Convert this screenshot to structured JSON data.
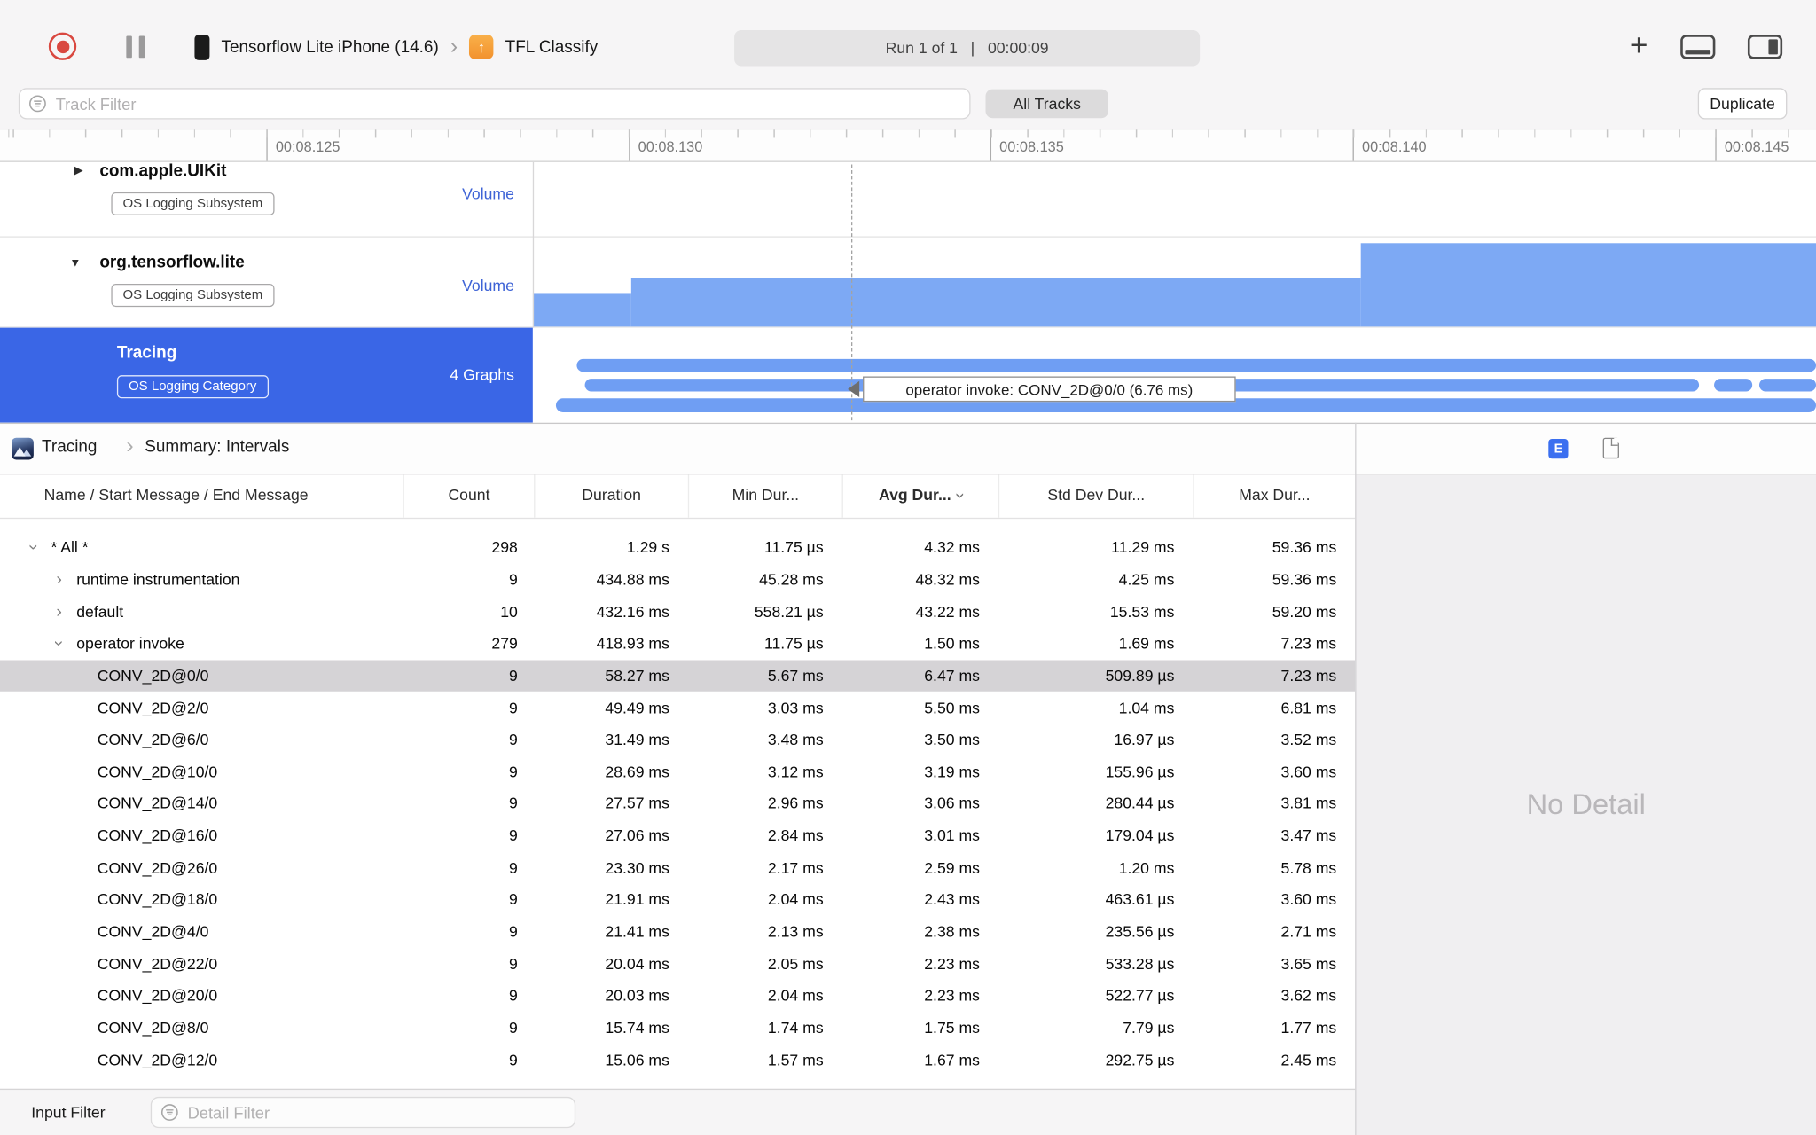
{
  "colors": {
    "record_red": "#d94840",
    "selection_blue": "#3a66e6",
    "bar_blue": "#7da9f4",
    "interval_blue": "#6f9ef3",
    "link_blue": "#3e63d6",
    "badge_blue": "#3b6ff0"
  },
  "icons": {
    "plus": "+",
    "chevron_right": "›",
    "triangle_collapsed": "▶",
    "triangle_expanded": "▼",
    "up_arrow": "↑"
  },
  "toolbar": {
    "device": "Tensorflow Lite iPhone (14.6)",
    "target": "TFL Classify",
    "run_status": "Run 1 of 1   |   00:00:09"
  },
  "filter_bar": {
    "track_filter_placeholder": "Track Filter",
    "all_tracks_label": "All Tracks",
    "duplicate_label": "Duplicate"
  },
  "ruler": {
    "labels": [
      "00:08.125",
      "00:08.130",
      "00:08.135",
      "00:08.140",
      "00:08.145"
    ]
  },
  "tracks": [
    {
      "name": "com.apple.UIKit",
      "badge": "OS Logging Subsystem",
      "meta": "Volume",
      "disclosure": "collapsed",
      "selected": false
    },
    {
      "name": "org.tensorflow.lite",
      "badge": "OS Logging Subsystem",
      "meta": "Volume",
      "disclosure": "expanded",
      "selected": false
    },
    {
      "name": "Tracing",
      "badge": "OS Logging Category",
      "meta": "4 Graphs",
      "disclosure": "none",
      "selected": true
    }
  ],
  "tooltip": {
    "text": "operator invoke: CONV_2D@0/0 (6.76 ms)"
  },
  "detail": {
    "breadcrumb": {
      "instrument": "Tracing",
      "page": "Summary: Intervals"
    },
    "inspector_badge": "E",
    "no_detail": "No Detail"
  },
  "table": {
    "headers": [
      "Name / Start Message / End Message",
      "Count",
      "Duration",
      "Min Dur...",
      "Avg Dur...",
      "Std Dev Dur...",
      "Max Dur..."
    ],
    "sorted_by": "Avg Dur...",
    "rows": [
      {
        "name": "* All *",
        "indent": 0,
        "chevron": "open",
        "count": "298",
        "duration": "1.29 s",
        "min": "11.75 µs",
        "avg": "4.32 ms",
        "std": "11.29 ms",
        "max": "59.36 ms",
        "selected": false
      },
      {
        "name": "runtime instrumentation",
        "indent": 1,
        "chevron": "closed",
        "count": "9",
        "duration": "434.88 ms",
        "min": "45.28 ms",
        "avg": "48.32 ms",
        "std": "4.25 ms",
        "max": "59.36 ms",
        "selected": false
      },
      {
        "name": "default",
        "indent": 1,
        "chevron": "closed",
        "count": "10",
        "duration": "432.16 ms",
        "min": "558.21 µs",
        "avg": "43.22 ms",
        "std": "15.53 ms",
        "max": "59.20 ms",
        "selected": false
      },
      {
        "name": "operator invoke",
        "indent": 1,
        "chevron": "open",
        "count": "279",
        "duration": "418.93 ms",
        "min": "11.75 µs",
        "avg": "1.50 ms",
        "std": "1.69 ms",
        "max": "7.23 ms",
        "selected": false
      },
      {
        "name": "CONV_2D@0/0",
        "indent": 2,
        "chevron": "none",
        "count": "9",
        "duration": "58.27 ms",
        "min": "5.67 ms",
        "avg": "6.47 ms",
        "std": "509.89 µs",
        "max": "7.23 ms",
        "selected": true
      },
      {
        "name": "CONV_2D@2/0",
        "indent": 2,
        "chevron": "none",
        "count": "9",
        "duration": "49.49 ms",
        "min": "3.03 ms",
        "avg": "5.50 ms",
        "std": "1.04 ms",
        "max": "6.81 ms",
        "selected": false
      },
      {
        "name": "CONV_2D@6/0",
        "indent": 2,
        "chevron": "none",
        "count": "9",
        "duration": "31.49 ms",
        "min": "3.48 ms",
        "avg": "3.50 ms",
        "std": "16.97 µs",
        "max": "3.52 ms",
        "selected": false
      },
      {
        "name": "CONV_2D@10/0",
        "indent": 2,
        "chevron": "none",
        "count": "9",
        "duration": "28.69 ms",
        "min": "3.12 ms",
        "avg": "3.19 ms",
        "std": "155.96 µs",
        "max": "3.60 ms",
        "selected": false
      },
      {
        "name": "CONV_2D@14/0",
        "indent": 2,
        "chevron": "none",
        "count": "9",
        "duration": "27.57 ms",
        "min": "2.96 ms",
        "avg": "3.06 ms",
        "std": "280.44 µs",
        "max": "3.81 ms",
        "selected": false
      },
      {
        "name": "CONV_2D@16/0",
        "indent": 2,
        "chevron": "none",
        "count": "9",
        "duration": "27.06 ms",
        "min": "2.84 ms",
        "avg": "3.01 ms",
        "std": "179.04 µs",
        "max": "3.47 ms",
        "selected": false
      },
      {
        "name": "CONV_2D@26/0",
        "indent": 2,
        "chevron": "none",
        "count": "9",
        "duration": "23.30 ms",
        "min": "2.17 ms",
        "avg": "2.59 ms",
        "std": "1.20 ms",
        "max": "5.78 ms",
        "selected": false
      },
      {
        "name": "CONV_2D@18/0",
        "indent": 2,
        "chevron": "none",
        "count": "9",
        "duration": "21.91 ms",
        "min": "2.04 ms",
        "avg": "2.43 ms",
        "std": "463.61 µs",
        "max": "3.60 ms",
        "selected": false
      },
      {
        "name": "CONV_2D@4/0",
        "indent": 2,
        "chevron": "none",
        "count": "9",
        "duration": "21.41 ms",
        "min": "2.13 ms",
        "avg": "2.38 ms",
        "std": "235.56 µs",
        "max": "2.71 ms",
        "selected": false
      },
      {
        "name": "CONV_2D@22/0",
        "indent": 2,
        "chevron": "none",
        "count": "9",
        "duration": "20.04 ms",
        "min": "2.05 ms",
        "avg": "2.23 ms",
        "std": "533.28 µs",
        "max": "3.65 ms",
        "selected": false
      },
      {
        "name": "CONV_2D@20/0",
        "indent": 2,
        "chevron": "none",
        "count": "9",
        "duration": "20.03 ms",
        "min": "2.04 ms",
        "avg": "2.23 ms",
        "std": "522.77 µs",
        "max": "3.62 ms",
        "selected": false
      },
      {
        "name": "CONV_2D@8/0",
        "indent": 2,
        "chevron": "none",
        "count": "9",
        "duration": "15.74 ms",
        "min": "1.74 ms",
        "avg": "1.75 ms",
        "std": "7.79 µs",
        "max": "1.77 ms",
        "selected": false
      },
      {
        "name": "CONV_2D@12/0",
        "indent": 2,
        "chevron": "none",
        "count": "9",
        "duration": "15.06 ms",
        "min": "1.57 ms",
        "avg": "1.67 ms",
        "std": "292.75 µs",
        "max": "2.45 ms",
        "selected": false
      }
    ]
  },
  "bottom_bar": {
    "label": "Input Filter",
    "detail_filter_placeholder": "Detail Filter"
  }
}
